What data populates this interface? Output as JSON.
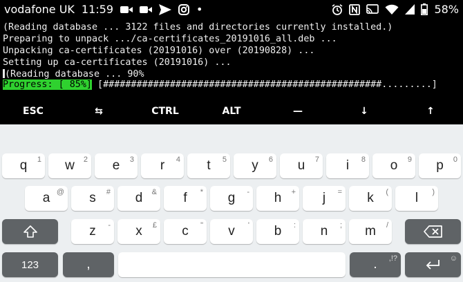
{
  "status": {
    "carrier": "vodafone UK",
    "time": "11:59",
    "battery": "58%",
    "left_icons": [
      "video-camera-icon",
      "video-camera-icon",
      "send-icon",
      "instagram-icon",
      "dot-icon"
    ],
    "right_icons": [
      "alarm-icon",
      "nfc-icon",
      "cast-icon",
      "wifi-icon",
      "signal-icon",
      "battery-icon"
    ],
    "dot": "•"
  },
  "terminal": {
    "lines": [
      "(Reading database ... 3122 files and directories currently installed.)",
      "Preparing to unpack .../ca-certificates_20191016_all.deb ...",
      "Unpacking ca-certificates (20191016) over (20190828) ...",
      "Setting up ca-certificates (20191016) ...",
      "(Reading database ... 90%"
    ],
    "progress_label": "Progress: [ 85%]",
    "progress_bar": " [##################################################.........]",
    "progress_value": 0.85,
    "colors": {
      "fg": "#f0f0f0",
      "bg": "#000000",
      "progress_bg": "#2fd12f"
    }
  },
  "extra_keys": [
    "ESC",
    "⇆",
    "CTRL",
    "ALT",
    "—",
    "↓",
    "↑"
  ],
  "keyboard": {
    "row1": [
      {
        "main": "q",
        "hint": "1"
      },
      {
        "main": "w",
        "hint": "2"
      },
      {
        "main": "e",
        "hint": "3"
      },
      {
        "main": "r",
        "hint": "4"
      },
      {
        "main": "t",
        "hint": "5"
      },
      {
        "main": "y",
        "hint": "6"
      },
      {
        "main": "u",
        "hint": "7"
      },
      {
        "main": "i",
        "hint": "8"
      },
      {
        "main": "o",
        "hint": "9"
      },
      {
        "main": "p",
        "hint": "0"
      }
    ],
    "row2": [
      {
        "main": "a",
        "hint": "@"
      },
      {
        "main": "s",
        "hint": "#"
      },
      {
        "main": "d",
        "hint": "&"
      },
      {
        "main": "f",
        "hint": "*"
      },
      {
        "main": "g",
        "hint": "-"
      },
      {
        "main": "h",
        "hint": "+"
      },
      {
        "main": "j",
        "hint": "="
      },
      {
        "main": "k",
        "hint": "("
      },
      {
        "main": "l",
        "hint": ")"
      }
    ],
    "row3": [
      {
        "main": "z",
        "hint": "-"
      },
      {
        "main": "x",
        "hint": "£"
      },
      {
        "main": "c",
        "hint": "\""
      },
      {
        "main": "v",
        "hint": "'"
      },
      {
        "main": "b",
        "hint": ":"
      },
      {
        "main": "n",
        "hint": ";"
      },
      {
        "main": "m",
        "hint": "/"
      }
    ],
    "symbols_label": "123",
    "comma_label": ",",
    "period_label": ".",
    "period_hint": ",!?",
    "emoji_hint": "☺",
    "colors": {
      "bg": "#eceff1",
      "key": "#ffffff",
      "dark_key": "#5f6366"
    }
  }
}
